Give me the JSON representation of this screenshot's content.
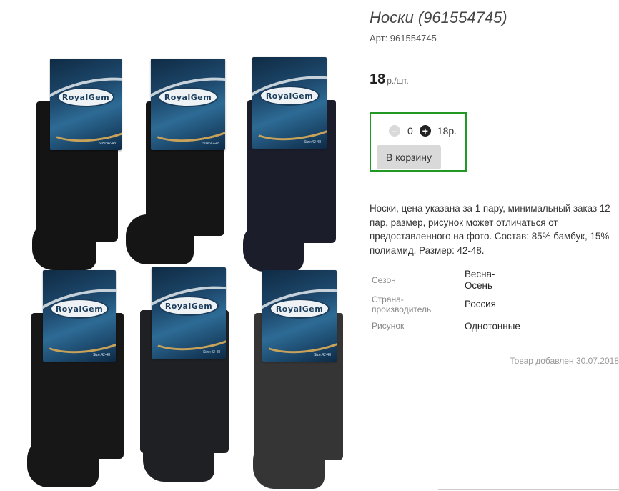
{
  "product": {
    "title": "Носки (961554745)",
    "sku": "Арт: 961554745",
    "price": "18",
    "price_unit": "р./шт.",
    "image_alt": "RoyalGem socks six pairs"
  },
  "cart": {
    "quantity": "0",
    "sum": "18р.",
    "button_label": "В корзину"
  },
  "description": "Носки, цена указана за 1 пару, минимальный заказ 12 пар, размер, рисунок может отличаться от предоставленного на фото. Состав: 85% бамбук, 15% полиамид. Размер: 42-48.",
  "properties": [
    {
      "key": "Сезон",
      "value": "Весна-Осень"
    },
    {
      "key": "Страна-производитель",
      "value": "Россия"
    },
    {
      "key": "Рисунок",
      "value": "Однотонные"
    }
  ],
  "added_text": "Товар добавлен 30.07.2018",
  "image": {
    "brand": "RoyalGem",
    "size_label": "Size:42-48",
    "sock_colors": [
      "#141414",
      "#151515",
      "#1b1d2b",
      "#171717",
      "#1f2023",
      "#353535"
    ]
  }
}
